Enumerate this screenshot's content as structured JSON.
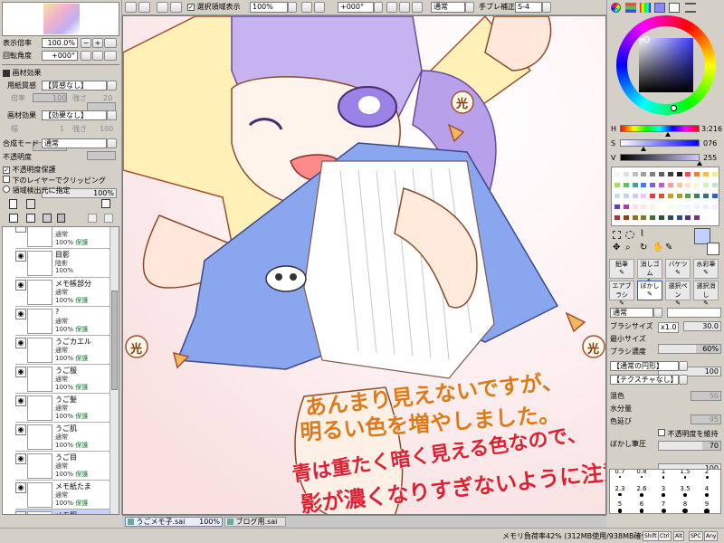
{
  "navigator": {
    "zoom_label": "表示倍率",
    "zoom_value": "100.0%",
    "angle_label": "回転角度",
    "angle_value": "+000°"
  },
  "texture": {
    "section": "画材効果",
    "paper_label": "用紙質感",
    "paper_value": "【質感なし】",
    "paper_scale_label": "倍率",
    "paper_scale_value": "100",
    "paper_strength_label": "強さ",
    "paper_strength_value": "20",
    "effect_label": "画材効果",
    "effect_value": "【効果なし】",
    "effect_width_label": "幅",
    "effect_width_value": "1",
    "effect_strength_label": "強さ",
    "effect_strength_value": "100"
  },
  "layer_props": {
    "blend_label": "合成モード",
    "blend_value": "通常",
    "opacity_label": "不透明度",
    "opacity_value": "100%",
    "opacity_fraction": 1.0,
    "preserve_opacity": "不透明度保護",
    "clip_lower": "下のレイヤーでクリッピング",
    "selection_source": "領域検出元に指定"
  },
  "layers": [
    {
      "name": "",
      "mode": "通常",
      "op": "100%",
      "prot": "保護",
      "visible": false,
      "selected": false
    },
    {
      "name": "目影",
      "mode": "陰影",
      "op": "100%",
      "prot": "",
      "visible": true,
      "selected": false
    },
    {
      "name": "メモ帳部分",
      "mode": "通常",
      "op": "100%",
      "prot": "保護",
      "visible": true,
      "selected": false
    },
    {
      "name": "?",
      "mode": "通常",
      "op": "100%",
      "prot": "保護",
      "visible": true,
      "selected": false
    },
    {
      "name": "うごカエル",
      "mode": "通常",
      "op": "100%",
      "prot": "保護",
      "visible": true,
      "selected": false
    },
    {
      "name": "うご服",
      "mode": "通常",
      "op": "100%",
      "prot": "保護",
      "visible": true,
      "selected": false
    },
    {
      "name": "うご髪",
      "mode": "通常",
      "op": "100%",
      "prot": "保護",
      "visible": true,
      "selected": false
    },
    {
      "name": "うご肌",
      "mode": "通常",
      "op": "100%",
      "prot": "保護",
      "visible": true,
      "selected": false
    },
    {
      "name": "うご目",
      "mode": "通常",
      "op": "100%",
      "prot": "保護",
      "visible": true,
      "selected": false
    },
    {
      "name": "メモ紙たま",
      "mode": "通常",
      "op": "100%",
      "prot": "保護",
      "visible": true,
      "selected": false
    },
    {
      "name": "メモ服",
      "mode": "通常",
      "op": "100%",
      "prot": "保護",
      "visible": true,
      "selected": true
    }
  ],
  "toolbar": {
    "selection_show": "選択領域表示",
    "zoom": "100%",
    "rotate": "+000°",
    "blend": "通常",
    "stabilizer_label": "手ブレ補正",
    "stabilizer_value": "S-4"
  },
  "tabs": [
    {
      "label": "うごメモ子.sai",
      "zoom": "100%"
    },
    {
      "label": "ブログ用.sai",
      "zoom": ""
    }
  ],
  "status": {
    "memory": "メモリ負荷率42% (312MB使用/938MB確保)",
    "keys": [
      "Shift",
      "Ctrl",
      "Alt",
      "SPC",
      "Any"
    ]
  },
  "color": {
    "h_label": "H",
    "h_value": "3:216",
    "h_fraction": 0.6,
    "s_label": "S",
    "s_value": "076",
    "s_fraction": 0.3,
    "v_label": "V",
    "v_value": "255",
    "v_fraction": 1.0,
    "current_color": "#c0d0ff",
    "ring_selected": "#9a9cf0"
  },
  "palette": [
    "#f5f5f5",
    "#e0e0e0",
    "#c0c0c0",
    "#a0a0a0",
    "#808080",
    "#606060",
    "#404040",
    "#202020",
    "#f05050",
    "#f08030",
    "#f0c040",
    "#f0f080",
    "#a0e060",
    "#60c060",
    "#40a0a0",
    "#4080f0",
    "#8060e0",
    "#c060c0",
    "#f0a0a0",
    "#f0c8a0",
    "#f8e8c0",
    "#fff8d0",
    "#d8f0c0",
    "#c0e8d0",
    "#c0e0f0",
    "#c0d0ff",
    "#d8c8f8",
    "#f0c8f0",
    "#e04040",
    "#c06030",
    "#c0a030",
    "#a0a040",
    "#60a040",
    "#408060",
    "#307080",
    "#3060c0",
    "#6040c0",
    "#a040a0",
    "#ffe0e0",
    "#ffe8d8",
    "#fff0e0",
    "#fffff0",
    "#f0fff0",
    "#e8fff8",
    "#e8f8ff",
    "#e8f0ff",
    "#f0e8ff",
    "#ffe8ff",
    "#b03030",
    "#904020",
    "#907020",
    "#708030",
    "#407030",
    "#305040",
    "#304860",
    "#304890",
    "#503090",
    "#803070"
  ],
  "tools": {
    "row1": [
      "鉛筆",
      "消しゴム",
      "バケツ",
      "水彩筆"
    ],
    "row2": [
      "エアブラシ",
      "ぼかし",
      "選択ペン",
      "選択消し"
    ]
  },
  "brush": {
    "shape_value": "通常",
    "size_label": "ブラシサイズ",
    "size_mult": "x1.0",
    "size_value": "30.0",
    "min_size_label": "最小サイズ",
    "min_size_value": "60%",
    "min_size_fraction": 0.6,
    "density_label": "ブラシ濃度",
    "density_value": "100",
    "density_fraction": 1.0,
    "shape_select": "【通常の円形】",
    "shape_strength": "50",
    "texture_select": "【テクスチャなし】",
    "texture_strength": "95",
    "mix_label": "混色",
    "mix_value": "70",
    "mix_fraction": 0.7,
    "water_label": "水分量",
    "water_value": "100",
    "water_fraction": 1.0,
    "stretch_label": "色延び",
    "stretch_value": "70",
    "stretch_fraction": 0.7,
    "keep_opacity": "不透明度を維持",
    "blur_label": "ぼかし筆圧"
  },
  "brush_sizes": [
    "0.7",
    "0.8",
    "1",
    "1.5",
    "2",
    "2.3",
    "2.6",
    "3",
    "3.5",
    "4",
    "5",
    "6",
    "7",
    "8",
    "9",
    "10",
    "12",
    "14",
    "16",
    "20",
    "25",
    "30",
    "35",
    "40",
    "50",
    "60",
    "70",
    "80",
    "100",
    "120"
  ],
  "annotations": {
    "line1": "あんまり見えないですが、",
    "line2": "明るい色を増やしました。",
    "line3": "青は重たく暗く見える色なので、",
    "line4": "影が濃くなりすぎないように注意。",
    "mark": "光"
  }
}
